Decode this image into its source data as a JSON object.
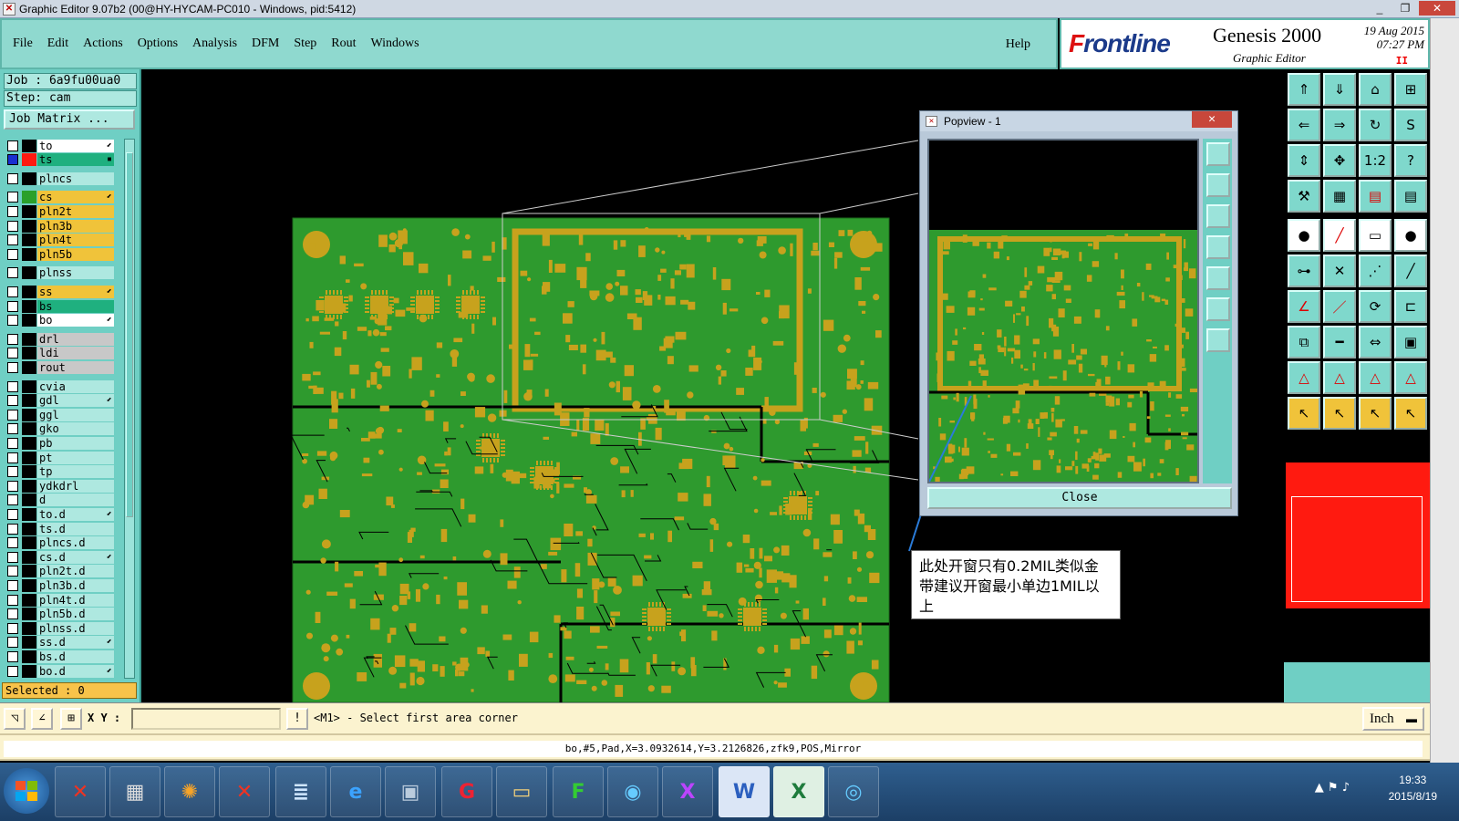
{
  "window": {
    "title": "Graphic Editor 9.07b2 (00@HY-HYCAM-PC010 - Windows, pid:5412)",
    "minimize": "_",
    "maximize": "❐",
    "close": "✕"
  },
  "menu": {
    "file": "File",
    "edit": "Edit",
    "actions": "Actions",
    "options": "Options",
    "analysis": "Analysis",
    "dfm": "DFM",
    "step": "Step",
    "rout": "Rout",
    "windows": "Windows",
    "help": "Help"
  },
  "brand": {
    "logo_prefix": "F",
    "logo_rest": "rontline",
    "product": "Genesis 2000",
    "subtitle": "Graphic Editor",
    "date": "19 Aug 2015",
    "time": "07:27 PM",
    "pause": "II"
  },
  "job": {
    "job_label": "Job : 6a9fu00ua0",
    "step_label": "Step: cam",
    "job_matrix": "Job Matrix ..."
  },
  "layers": [
    {
      "name": "to",
      "color": "#ffffff",
      "ind": "#000000",
      "arrow": "⬋"
    },
    {
      "name": "ts",
      "color": "#1fb07f",
      "ind": "#ff1a10",
      "arrow": "▪",
      "active": true
    },
    {
      "name": "plncs",
      "color": "#aee8e0",
      "ind": "#000000",
      "arrow": ""
    },
    {
      "name": "cs",
      "color": "#f0c33a",
      "ind": "#2aa02a",
      "arrow": "⬋"
    },
    {
      "name": "pln2t",
      "color": "#f0c33a",
      "ind": "#000000",
      "arrow": ""
    },
    {
      "name": "pln3b",
      "color": "#f0c33a",
      "ind": "#000000",
      "arrow": ""
    },
    {
      "name": "pln4t",
      "color": "#f0c33a",
      "ind": "#000000",
      "arrow": ""
    },
    {
      "name": "pln5b",
      "color": "#f0c33a",
      "ind": "#000000",
      "arrow": ""
    },
    {
      "name": "plnss",
      "color": "#aee8e0",
      "ind": "#000000",
      "arrow": ""
    },
    {
      "name": "ss",
      "color": "#f0c33a",
      "ind": "#000000",
      "arrow": "⬋"
    },
    {
      "name": "bs",
      "color": "#1fb07f",
      "ind": "#000000",
      "arrow": ""
    },
    {
      "name": "bo",
      "color": "#ffffff",
      "ind": "#000000",
      "arrow": "⬋"
    },
    {
      "name": "drl",
      "color": "#c8c8c8",
      "ind": "#000000",
      "arrow": ""
    },
    {
      "name": "ldi",
      "color": "#c8c8c8",
      "ind": "#000000",
      "arrow": ""
    },
    {
      "name": "rout",
      "color": "#c8c8c8",
      "ind": "#000000",
      "arrow": ""
    },
    {
      "name": "cvia",
      "color": "#aee8e0",
      "ind": "#000000",
      "arrow": ""
    },
    {
      "name": "gdl",
      "color": "#aee8e0",
      "ind": "#000000",
      "arrow": "⬋"
    },
    {
      "name": "ggl",
      "color": "#aee8e0",
      "ind": "#000000",
      "arrow": ""
    },
    {
      "name": "gko",
      "color": "#aee8e0",
      "ind": "#000000",
      "arrow": ""
    },
    {
      "name": "pb",
      "color": "#aee8e0",
      "ind": "#000000",
      "arrow": ""
    },
    {
      "name": "pt",
      "color": "#aee8e0",
      "ind": "#000000",
      "arrow": ""
    },
    {
      "name": "tp",
      "color": "#aee8e0",
      "ind": "#000000",
      "arrow": ""
    },
    {
      "name": "ydkdrl",
      "color": "#aee8e0",
      "ind": "#000000",
      "arrow": ""
    },
    {
      "name": "d",
      "color": "#aee8e0",
      "ind": "#000000",
      "arrow": ""
    },
    {
      "name": "to.d",
      "color": "#aee8e0",
      "ind": "#000000",
      "arrow": "⬋"
    },
    {
      "name": "ts.d",
      "color": "#aee8e0",
      "ind": "#000000",
      "arrow": ""
    },
    {
      "name": "plncs.d",
      "color": "#aee8e0",
      "ind": "#000000",
      "arrow": ""
    },
    {
      "name": "cs.d",
      "color": "#aee8e0",
      "ind": "#000000",
      "arrow": "⬋"
    },
    {
      "name": "pln2t.d",
      "color": "#aee8e0",
      "ind": "#000000",
      "arrow": ""
    },
    {
      "name": "pln3b.d",
      "color": "#aee8e0",
      "ind": "#000000",
      "arrow": ""
    },
    {
      "name": "pln4t.d",
      "color": "#aee8e0",
      "ind": "#000000",
      "arrow": ""
    },
    {
      "name": "pln5b.d",
      "color": "#aee8e0",
      "ind": "#000000",
      "arrow": ""
    },
    {
      "name": "plnss.d",
      "color": "#aee8e0",
      "ind": "#000000",
      "arrow": ""
    },
    {
      "name": "ss.d",
      "color": "#aee8e0",
      "ind": "#000000",
      "arrow": "⬋"
    },
    {
      "name": "bs.d",
      "color": "#aee8e0",
      "ind": "#000000",
      "arrow": ""
    },
    {
      "name": "bo.d",
      "color": "#aee8e0",
      "ind": "#000000",
      "arrow": "⬋"
    }
  ],
  "selected": "Selected : 0",
  "popview": {
    "title": "Popview - 1",
    "close_btn": "Close",
    "close_x": "✕"
  },
  "annotation": {
    "text": "此处开窗只有0.2MIL类似金带建议开窗最小单边1MIL以上"
  },
  "command": {
    "xy_label": "X Y :",
    "xy_value": "",
    "prompt": "<M1> - Select first area corner",
    "units": "Inch",
    "units_arrow": "▬"
  },
  "status": {
    "text": "bo,#5,Pad,X=3.0932614,Y=3.2126826,zfk9,POS,Mirror"
  },
  "right_tools": [
    {
      "icon": "home-up-icon",
      "glyph": "⇑",
      "style": ""
    },
    {
      "icon": "down-icon",
      "glyph": "⇓",
      "style": ""
    },
    {
      "icon": "home-icon",
      "glyph": "⌂",
      "style": ""
    },
    {
      "icon": "window-icon",
      "glyph": "⊞",
      "style": ""
    },
    {
      "icon": "left-icon",
      "glyph": "⇐",
      "style": ""
    },
    {
      "icon": "right-icon",
      "glyph": "⇒",
      "style": ""
    },
    {
      "icon": "loop-icon",
      "glyph": "↻",
      "style": ""
    },
    {
      "icon": "s-curve-icon",
      "glyph": "S",
      "style": ""
    },
    {
      "icon": "vertical-arrows-icon",
      "glyph": "⇕",
      "style": ""
    },
    {
      "icon": "cross-arrows-icon",
      "glyph": "✥",
      "style": ""
    },
    {
      "icon": "scale-icon",
      "glyph": "1:2",
      "style": ""
    },
    {
      "icon": "help-icon",
      "glyph": "?",
      "style": ""
    },
    {
      "icon": "tools-icon",
      "glyph": "⚒",
      "style": ""
    },
    {
      "icon": "grid-icon",
      "glyph": "▦",
      "style": ""
    },
    {
      "icon": "layers-red-icon",
      "glyph": "▤",
      "style": ""
    },
    {
      "icon": "layers-icon",
      "glyph": "▤",
      "style": ""
    },
    {
      "icon": "pad-icon",
      "glyph": "●",
      "style": "white"
    },
    {
      "icon": "line-red-icon",
      "glyph": "╱",
      "style": "white"
    },
    {
      "icon": "ruler-icon",
      "glyph": "▭",
      "style": "white"
    },
    {
      "icon": "dot-icon",
      "glyph": "●",
      "style": "white"
    },
    {
      "icon": "node-icon",
      "glyph": "⊶",
      "style": ""
    },
    {
      "icon": "cross-icon",
      "glyph": "✕",
      "style": ""
    },
    {
      "icon": "dotted-line-icon",
      "glyph": "⋰",
      "style": ""
    },
    {
      "icon": "diagonal-icon",
      "glyph": "╱",
      "style": ""
    },
    {
      "icon": "angle-icon",
      "glyph": "∠",
      "style": ""
    },
    {
      "icon": "slash-icon",
      "glyph": "／",
      "style": ""
    },
    {
      "icon": "arc-icon",
      "glyph": "⟳",
      "style": ""
    },
    {
      "icon": "frame-icon",
      "glyph": "⊏",
      "style": ""
    },
    {
      "icon": "copy-icon",
      "glyph": "⧉",
      "style": ""
    },
    {
      "icon": "minus-icon",
      "glyph": "━",
      "style": ""
    },
    {
      "icon": "measure-icon",
      "glyph": "⇔",
      "style": ""
    },
    {
      "icon": "blocks-icon",
      "glyph": "▣",
      "style": ""
    },
    {
      "icon": "triangle-a-icon",
      "glyph": "△",
      "style": ""
    },
    {
      "icon": "triangle-b-icon",
      "glyph": "△",
      "style": ""
    },
    {
      "icon": "triangle-c-icon",
      "glyph": "△",
      "style": ""
    },
    {
      "icon": "triangle-d-icon",
      "glyph": "△",
      "style": ""
    },
    {
      "icon": "pointer-icon",
      "glyph": "↖",
      "style": "yellow"
    },
    {
      "icon": "pointer-select-icon",
      "glyph": "↖",
      "style": "yellow"
    },
    {
      "icon": "pointer-multi-icon",
      "glyph": "↖",
      "style": "yellow"
    },
    {
      "icon": "pointer-node-icon",
      "glyph": "↖",
      "style": "yellow"
    }
  ],
  "taskbar": {
    "time": "19:33",
    "date": "2015/8/19",
    "tray": "▲ ⚑ ♪"
  },
  "colors": {
    "board": "#2e9a2e",
    "copper": "#c7a21d",
    "ui_teal": "#6fcfc4",
    "highlight_red": "#ff1a10"
  }
}
